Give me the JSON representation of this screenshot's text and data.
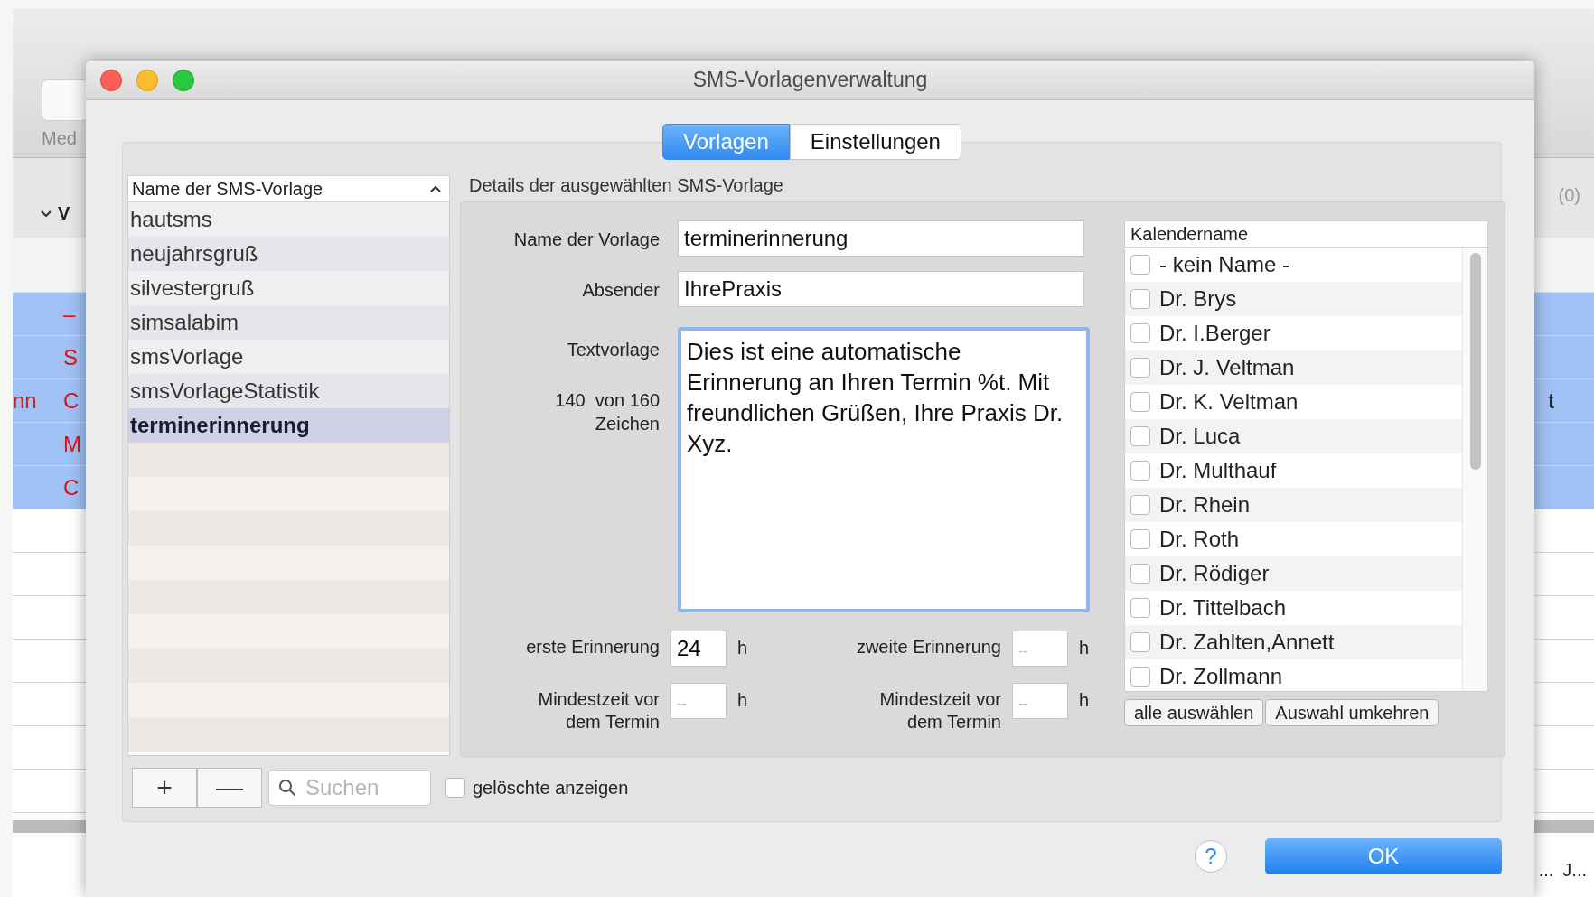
{
  "background_app": {
    "toolbar_label": "Med",
    "column_header": "V",
    "counter": "(0)",
    "rows": [
      {
        "left": "",
        "mid": "–",
        "right": ""
      },
      {
        "left": "",
        "mid": "S",
        "right": ""
      },
      {
        "left": "nn",
        "mid": "C",
        "right": "t"
      },
      {
        "left": "",
        "mid": "M",
        "right": ""
      },
      {
        "left": "",
        "mid": "C",
        "right": ""
      }
    ],
    "footer": [
      "...",
      "J..."
    ]
  },
  "window": {
    "title": "SMS-Vorlagenverwaltung"
  },
  "tabs": [
    {
      "label": "Vorlagen",
      "selected": true
    },
    {
      "label": "Einstellungen",
      "selected": false
    }
  ],
  "template_list": {
    "header": "Name der SMS-Vorlage",
    "items": [
      {
        "label": "hautsms",
        "selected": false
      },
      {
        "label": "neujahrsgruß",
        "selected": false
      },
      {
        "label": "silvestergruß",
        "selected": false
      },
      {
        "label": "simsalabim",
        "selected": false
      },
      {
        "label": "smsVorlage",
        "selected": false
      },
      {
        "label": "smsVorlageStatistik",
        "selected": false
      },
      {
        "label": "terminerinnerung",
        "selected": true
      }
    ]
  },
  "add_button": "+",
  "remove_button": "—",
  "search": {
    "placeholder": "Suchen"
  },
  "show_deleted": {
    "label": "gelöschte anzeigen",
    "checked": false
  },
  "details": {
    "title": "Details der ausgewählten SMS-Vorlage",
    "name_label": "Name der Vorlage",
    "name_value": "terminerinnerung",
    "sender_label": "Absender",
    "sender_value": "IhrePraxis",
    "text_label": "Textvorlage",
    "char_count": "140  von 160",
    "char_unit": "Zeichen",
    "text_value": "Dies ist eine automatische Erinnerung an Ihren Termin %t. Mit freundlichen Grüßen, Ihre Praxis Dr. Xyz.",
    "reminders": [
      {
        "label": "erste Erinnerung",
        "value": "24",
        "unit": "h"
      },
      {
        "label": "zweite Erinnerung",
        "placeholder": "--",
        "unit": "h"
      },
      {
        "label": "Mindestzeit vor dem Termin",
        "placeholder": "--",
        "unit": "h"
      },
      {
        "label": "Mindestzeit vor dem Termin",
        "placeholder": "--",
        "unit": "h"
      }
    ]
  },
  "calendars": {
    "header": "Kalendername",
    "items": [
      {
        "label": "- kein Name -",
        "checked": false
      },
      {
        "label": "Dr. Brys",
        "checked": false
      },
      {
        "label": "Dr. I.Berger",
        "checked": false
      },
      {
        "label": "Dr. J. Veltman",
        "checked": false
      },
      {
        "label": "Dr. K. Veltman",
        "checked": false
      },
      {
        "label": "Dr. Luca",
        "checked": false
      },
      {
        "label": "Dr. Multhauf",
        "checked": false
      },
      {
        "label": "Dr. Rhein",
        "checked": false
      },
      {
        "label": "Dr. Roth",
        "checked": false
      },
      {
        "label": "Dr. Rödiger",
        "checked": false
      },
      {
        "label": "Dr. Tittelbach",
        "checked": false
      },
      {
        "label": "Dr. Zahlten,Annett",
        "checked": false
      },
      {
        "label": "Dr. Zollmann",
        "checked": false
      }
    ],
    "buttons": [
      "alle auswählen",
      "Auswahl umkehren"
    ]
  },
  "help_button": "?",
  "ok_button": "OK"
}
